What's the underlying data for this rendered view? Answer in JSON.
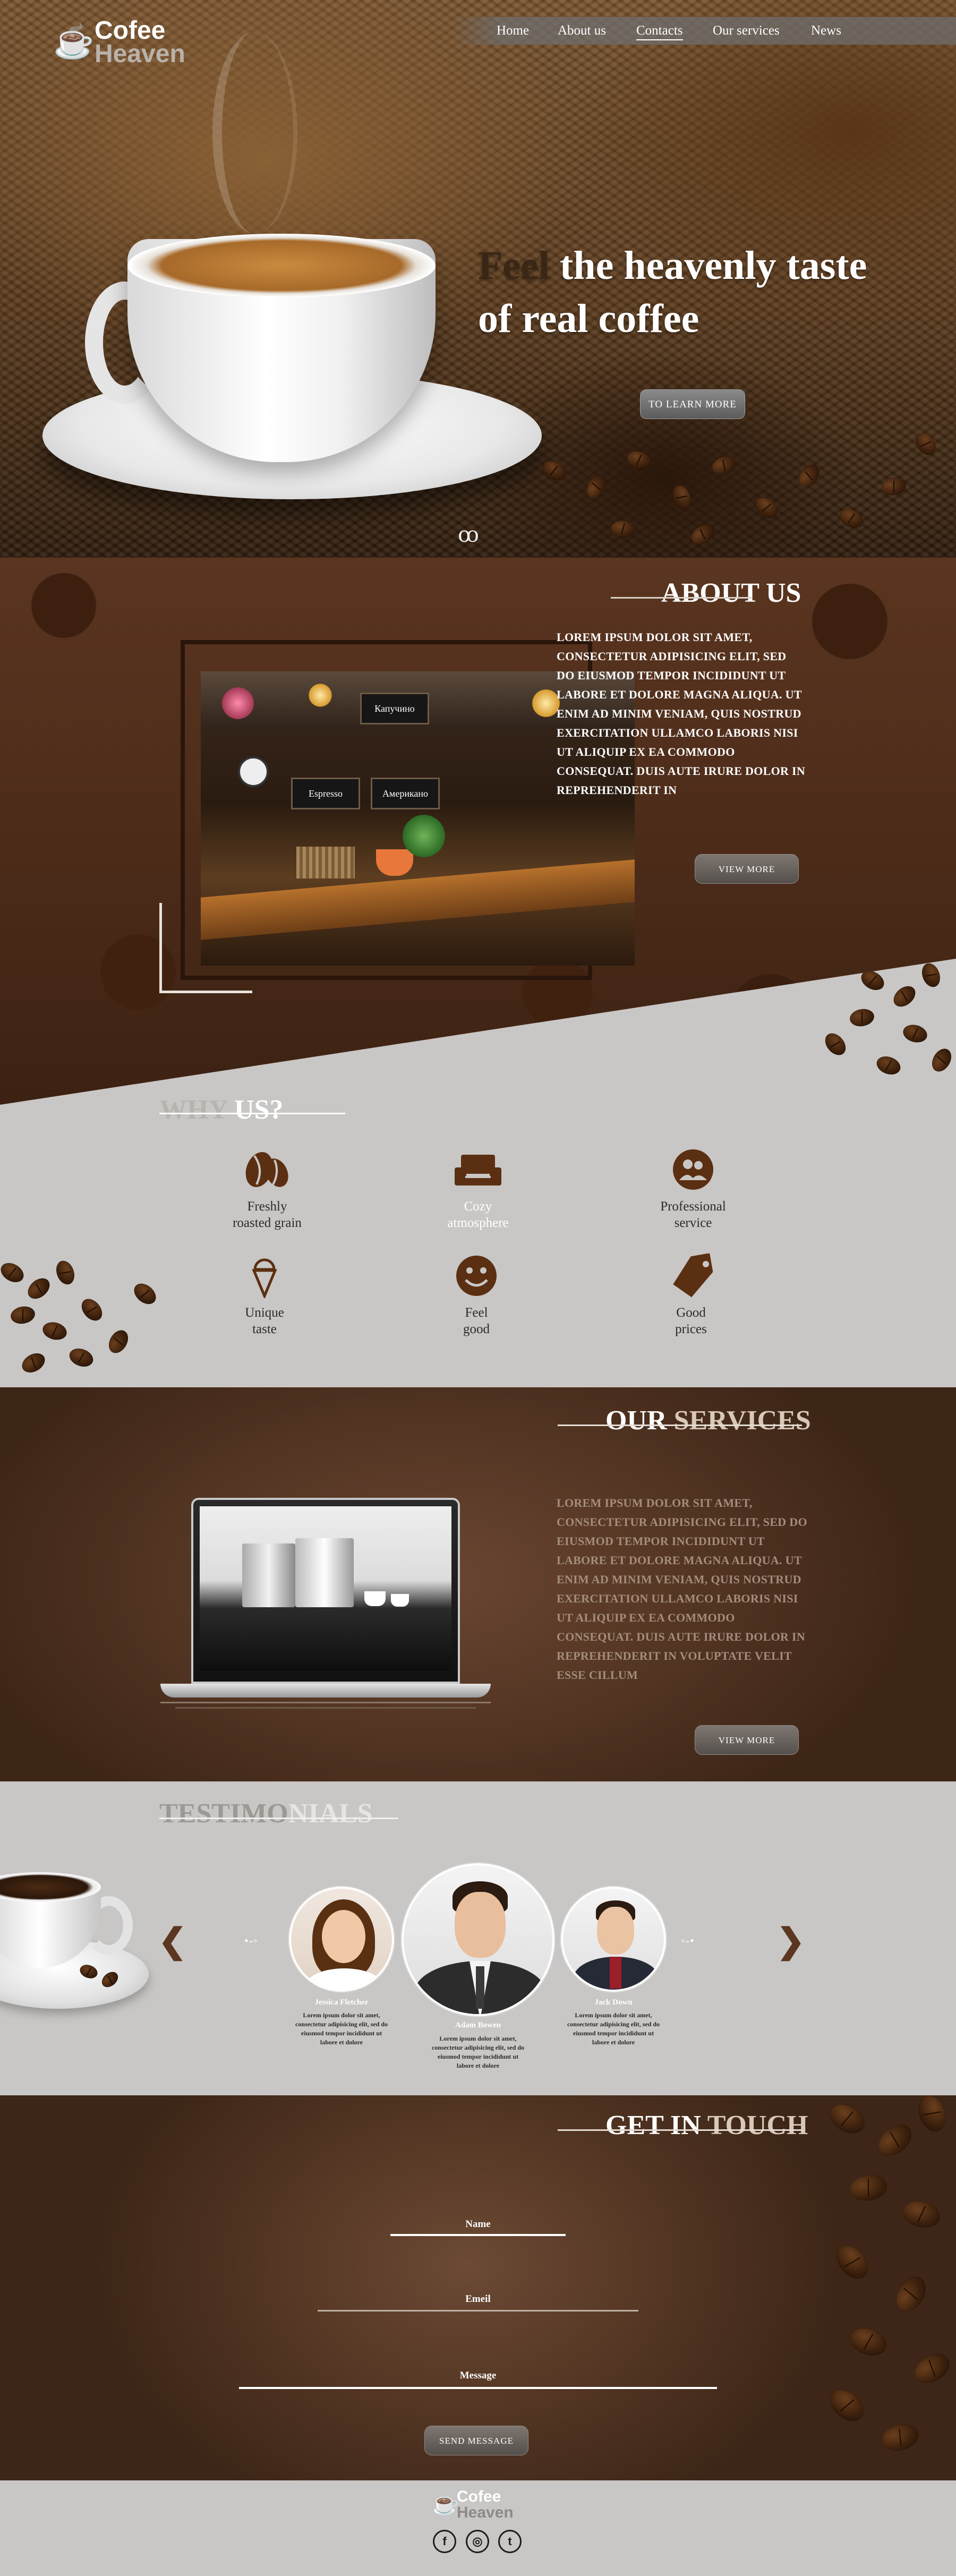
{
  "brand": {
    "line1": "Cofee",
    "line2": "Heaven",
    "logo_icon": "coffee-cup-icon"
  },
  "nav": {
    "items": [
      {
        "label": "Home"
      },
      {
        "label": "About us"
      },
      {
        "label": "Contacts"
      },
      {
        "label": "Our services"
      },
      {
        "label": "News"
      }
    ],
    "active": "Contacts"
  },
  "hero": {
    "word_feel": "Feel",
    "line1_rest": " the heavenly taste",
    "line2": "of real coffee",
    "button": "TO LEARN MORE",
    "ornament": "ꝏ"
  },
  "about": {
    "title": "ABOUT US",
    "body": "LOREM IPSUM DOLOR SIT AMET, CONSECTETUR ADIPISICING ELIT, SED DO EIUSMOD TEMPOR INCIDIDUNT UT LABORE ET DOLORE MAGNA ALIQUA. UT ENIM AD MINIM VENIAM, QUIS NOSTRUD EXERCITATION ULLAMCO LABORIS NISI UT ALIQUIP EX EA COMMODO CONSEQUAT. DUIS AUTE IRURE DOLOR IN REPREHENDERIT IN",
    "button": "VIEW MORE",
    "photo_signs": [
      "Espresso",
      "Капучино",
      "Американо"
    ]
  },
  "why": {
    "title_a": "WHY ",
    "title_b": "US?",
    "items": [
      {
        "l1": "Freshly",
        "l2": "roasted grain",
        "icon": "coffee-bean-icon"
      },
      {
        "l1": "Cozy",
        "l2": "atmosphere",
        "icon": "sofa-icon"
      },
      {
        "l1": "Professional",
        "l2": "service",
        "icon": "people-icon"
      },
      {
        "l1": "Unique",
        "l2": "taste",
        "icon": "ice-cream-icon"
      },
      {
        "l1": "Feel",
        "l2": "good",
        "icon": "smiley-icon"
      },
      {
        "l1": "Good",
        "l2": "prices",
        "icon": "price-tag-icon"
      }
    ]
  },
  "services": {
    "title_a": "OUR ",
    "title_b": "SERVICES",
    "body": "LOREM IPSUM DOLOR SIT AMET, CONSECTETUR ADIPISICING ELIT, SED DO EIUSMOD TEMPOR INCIDIDUNT UT LABORE ET DOLORE MAGNA ALIQUA. UT ENIM AD MINIM VENIAM, QUIS NOSTRUD EXERCITATION ULLAMCO LABORIS NISI UT ALIQUIP EX EA COMMODO CONSEQUAT. DUIS AUTE IRURE DOLOR IN REPREHENDERIT IN VOLUPTATE VELIT ESSE CILLUM",
    "button": "VIEW MORE"
  },
  "testimonials": {
    "title_a": "TESTIMO",
    "title_b": "NIALS",
    "prev": "❮",
    "next": "❯",
    "dots_left": "•-◦",
    "dots_right": "◦-•",
    "people": [
      {
        "name": "Jessica Fletcher",
        "text": "Lorem ipsum dolor sit amet, consectetur adipisicing elit, sed do eiusmod tempor incididunt ut labore et dolore"
      },
      {
        "name": "Adam Bowen",
        "text": "Lorem ipsum dolor sit amet, consectetur adipisicing elit, sed do eiusmod tempor incididunt ut labore et dolore"
      },
      {
        "name": "Jack Down",
        "text": "Lorem ipsum dolor sit amet, consectetur adipisicing elit, sed do eiusmod tempor incididunt ut labore et dolore"
      }
    ]
  },
  "contact": {
    "title_a": "GET IN ",
    "title_b": "TOUCH",
    "name_label": "Name",
    "email_label": "Emeil",
    "message_label": "Message",
    "button": "SEND MESSAGE"
  },
  "footer": {
    "line1": "Cofee",
    "line2": "Heaven",
    "social": [
      {
        "glyph": "f",
        "icon": "facebook-icon"
      },
      {
        "glyph": "◎",
        "icon": "instagram-icon"
      },
      {
        "glyph": "t",
        "icon": "twitter-icon"
      }
    ]
  }
}
